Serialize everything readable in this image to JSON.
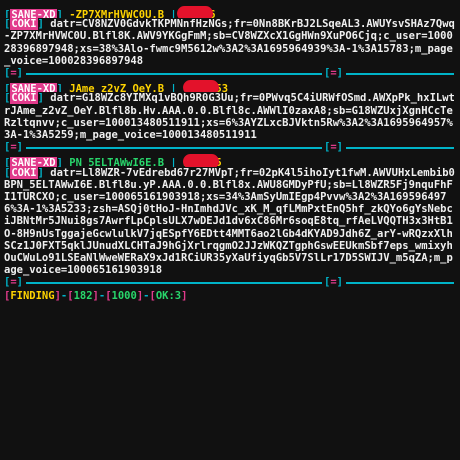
{
  "accounts": [
    {
      "tag": "SANE-XD",
      "uid": "-ZP7XMrHVWC0U.B",
      "name": "6",
      "coki_label": "COKI",
      "cookie": "datr=CV8NZV0GdvkTKPMNnfHzNGs;fr=0Nn8BKrBJ2LSqeAL3.AWUYsvSHAz7Qwq-ZP7XMrHVWC0U.Blfl8K.AWV9YKGgFmM;sb=CV8WZXcX1GgHWn9XuPO6Cjq;c_user=100028396897948;xs=38%3Alo-fwmc9M5612w%3A2%3A1695964939%3A-1%3A15783;m_page_voice=100028396897948"
    },
    {
      "tag": "SANE-XD",
      "uid": "JAme_z2vZ_OeY.B",
      "name": "53",
      "coki_label": "COKI",
      "cookie": "datr=G18WZc8YIMXq1vBQh9R0G3Uu;fr=0PWvq5C4iURWfOSmd.AWXpPk_hxILwtrJAme_z2vZ_OeY.Blfl8b.Hv.AAA.0.0.Blfl8c.AWWlI0zaxA8;sb=G18WZUxjXgnHCcTeRzltqnvv;c_user=100013480511911;xs=6%3AYZLxcBJVktn5Rw%3A2%3A1695964957%3A-1%3A5259;m_page_voice=100013480511911"
    },
    {
      "tag": "SANE-XD",
      "uid": "PN_5ELTAWwI6E.B",
      "name": "5",
      "name_tail": "5",
      "coki_label": "COKI",
      "cookie": "datr=Ll8WZR-7vEdrebd67r27MVpT;fr=02pK4l5ihoIyt1fwM.AWVUHxLembib0BPN_5ELTAWwI6E.Blfl8u.yP.AAA.0.0.Blfl8x.AWU8GMDyPfU;sb=Ll8WZR5Fj9nquFhFI1TURCXO;c_user=100065161903918;xs=34%3AmSyUmIEgp4Pvvw%3A2%3A1695964976%3A-1%3A5233;zsh=ASQj0tHoJ-HnImhdJVc_xK_M_qfLMmPxtEnQ5hf_zkQYo6gYsNebciJBNtMr5JNui8gs7AwrfLpCplsULX7wDEJd1dv6xC86Mr6soqE8tq_rfAeLVQQTH3x3HtB1O-8H9nUsTggajeGcwlulkV7jqESpfY6EDtt4MMT6ao2lGb4dKYAD9Jdh6Z_arY-wRQzxXlhSCz1J0FXT5qklJUnudXLCHTaJ9hGjXrlrqgmO2JJzWKQZTgphGswEEUkmSbf7eps_wmixyhOuCWuLo91LSEaNlWweWERaX9xJd1RCiUR35yXaUfiyqGb5V7SlLr17D5SWIJV_m5qZA;m_page_voice=100065161903918"
    }
  ],
  "status": {
    "label": "FINDING",
    "found": "182",
    "total": "1000",
    "ok": "OK:3"
  },
  "colors": {
    "background": "#111111",
    "accent_pink": "#e23b8c",
    "accent_cyan": "#00b3c8",
    "uid_yellow": "#ffd400",
    "name_green": "#28d66b",
    "redaction_red": "#e3122b"
  }
}
